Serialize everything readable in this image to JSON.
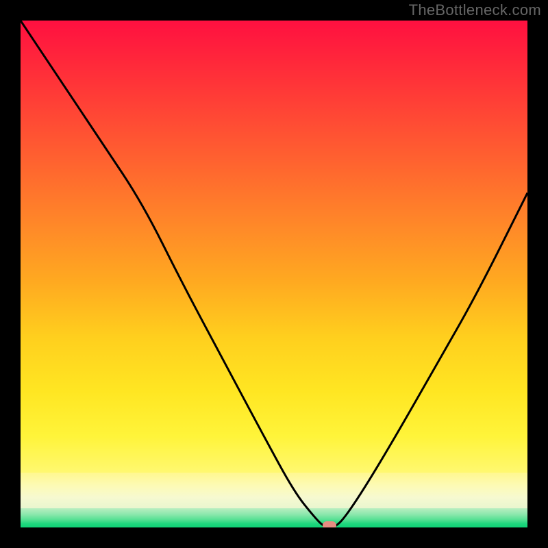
{
  "watermark": "TheBottleneck.com",
  "chart_data": {
    "type": "line",
    "title": "",
    "xlabel": "",
    "ylabel": "",
    "xlim": [
      0,
      100
    ],
    "ylim": [
      0,
      100
    ],
    "background_gradient": {
      "orientation": "vertical",
      "stops": [
        {
          "pos": 0.0,
          "color": "#ff1040"
        },
        {
          "pos": 0.3,
          "color": "#ff6a2e"
        },
        {
          "pos": 0.6,
          "color": "#ffcf1e"
        },
        {
          "pos": 0.85,
          "color": "#fff870"
        },
        {
          "pos": 0.93,
          "color": "#f6f9d0"
        },
        {
          "pos": 1.0,
          "color": "#0fd176"
        }
      ]
    },
    "series": [
      {
        "name": "bottleneck-curve",
        "color": "#000000",
        "x": [
          0,
          8,
          16,
          24,
          32,
          40,
          48,
          54,
          58,
          60,
          62,
          64,
          68,
          74,
          82,
          90,
          100
        ],
        "y": [
          100,
          88,
          76,
          64,
          48,
          33,
          18,
          7,
          2,
          0,
          0,
          2,
          8,
          18,
          32,
          46,
          66
        ]
      }
    ],
    "marker": {
      "name": "optimal-point",
      "x": 61,
      "y": 0,
      "color": "#e78d82"
    },
    "annotations": []
  }
}
